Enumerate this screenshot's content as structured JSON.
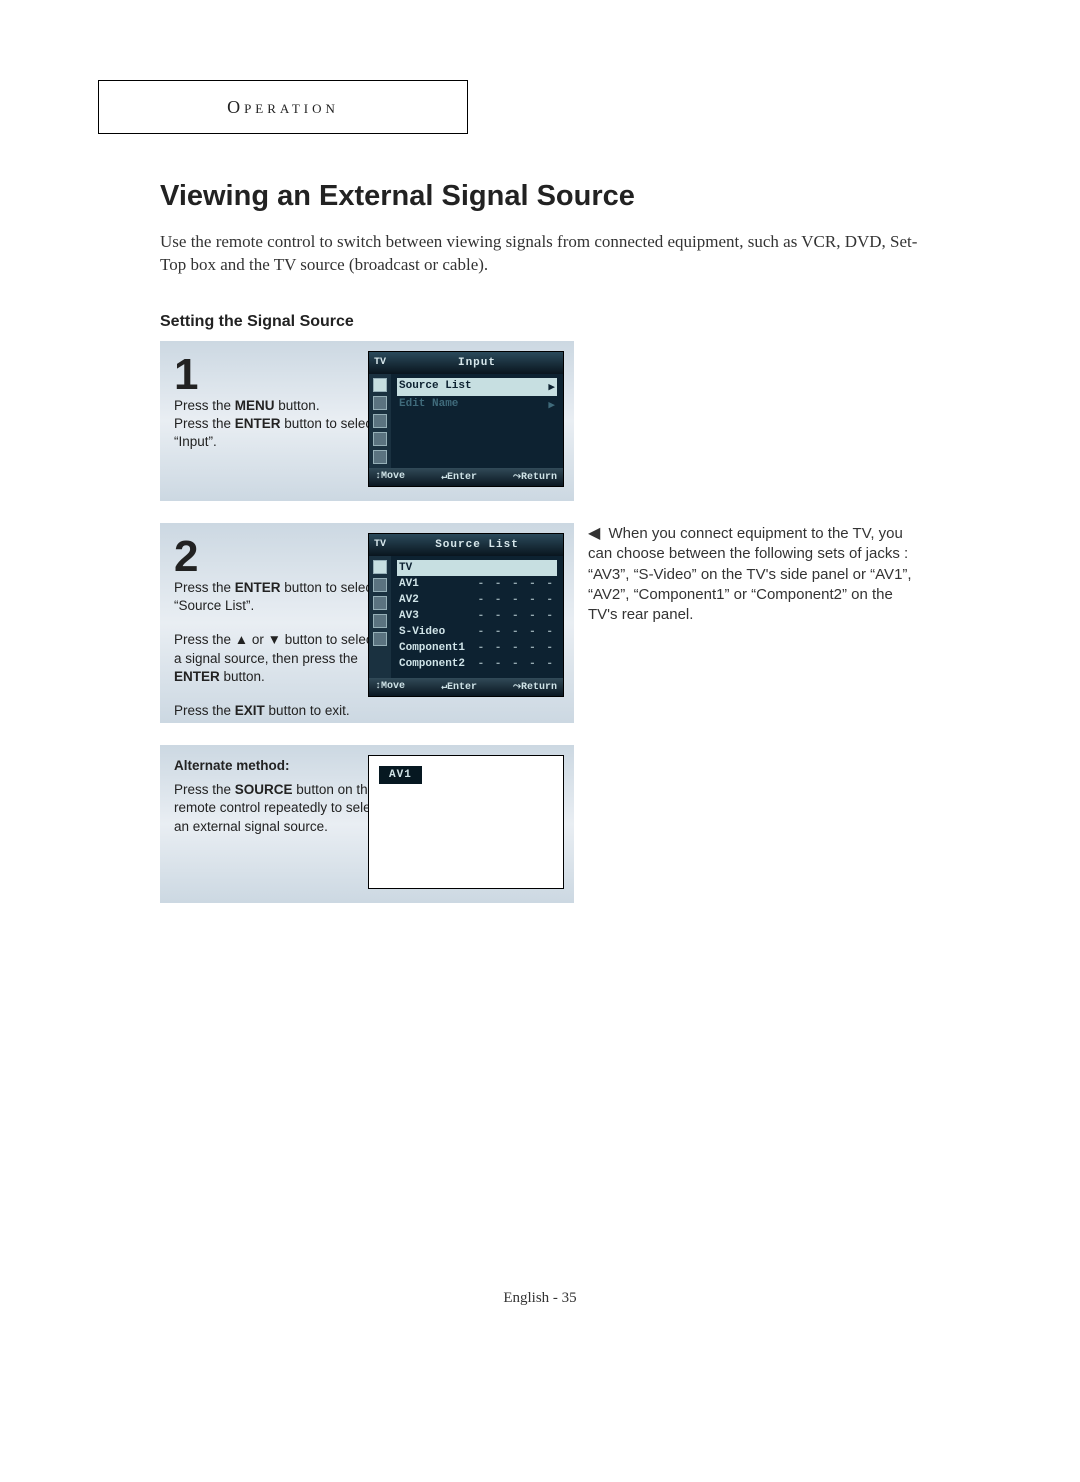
{
  "header": "Operation",
  "title": "Viewing an External Signal Source",
  "intro": "Use the remote control to switch between viewing signals from connected equipment, such as VCR, DVD, Set-Top box and the TV source (broadcast or cable).",
  "subhead": "Setting the Signal Source",
  "steps": {
    "one": {
      "num": "1",
      "line1_a": "Press the ",
      "line1_b": "MENU",
      "line1_c": " button.",
      "line2_a": "Press the ",
      "line2_b": "ENTER",
      "line2_c": " button to select “Input”."
    },
    "two": {
      "num": "2",
      "l1_a": "Press the ",
      "l1_b": "ENTER",
      "l1_c": " button to select “Source List”.",
      "l2_a": "Press the ",
      "l2_b": "▲ or ▼",
      "l2_c": " button to select a signal source, then press the ",
      "l2_d": "ENTER",
      "l2_e": " button.",
      "l3_a": "Press the ",
      "l3_b": "EXIT",
      "l3_c": " button to exit."
    },
    "alt": {
      "head": "Alternate method:",
      "l_a": "Press the ",
      "l_b": "SOURCE",
      "l_c": " button on the remote control repeatedly to select an external signal source."
    }
  },
  "osd1": {
    "tv": "TV",
    "title": "Input",
    "rows": [
      {
        "label": "Source List",
        "arrow": "▶",
        "sel": true
      },
      {
        "label": "Edit Name",
        "arrow": "▶",
        "sel": false
      }
    ],
    "footer": {
      "move": "↕Move",
      "enter": "↵Enter",
      "ret": "⤳Return"
    }
  },
  "osd2": {
    "tv": "TV",
    "title": "Source List",
    "rows": [
      {
        "label": "TV",
        "val": "",
        "sel": true
      },
      {
        "label": "AV1",
        "val": "- - - - -",
        "sel": false
      },
      {
        "label": "AV2",
        "val": "- - - - -",
        "sel": false
      },
      {
        "label": "AV3",
        "val": "- - - - -",
        "sel": false
      },
      {
        "label": "S-Video",
        "val": "- - - - -",
        "sel": false
      },
      {
        "label": "Component1",
        "val": "- - - - -",
        "sel": false
      },
      {
        "label": "Component2",
        "val": "- - - - -",
        "sel": false
      }
    ],
    "footer": {
      "move": "↕Move",
      "enter": "↵Enter",
      "ret": "⤳Return"
    }
  },
  "osd3": {
    "label": "AV1"
  },
  "sidenote": {
    "arrow": "◀",
    "text": " When you connect equipment to the TV, you can choose between the following sets of jacks : “AV3”, “S-Video” on the TV's side panel or “AV1”, “AV2”, “Component1” or “Component2” on the TV's rear panel."
  },
  "footer": "English - 35"
}
